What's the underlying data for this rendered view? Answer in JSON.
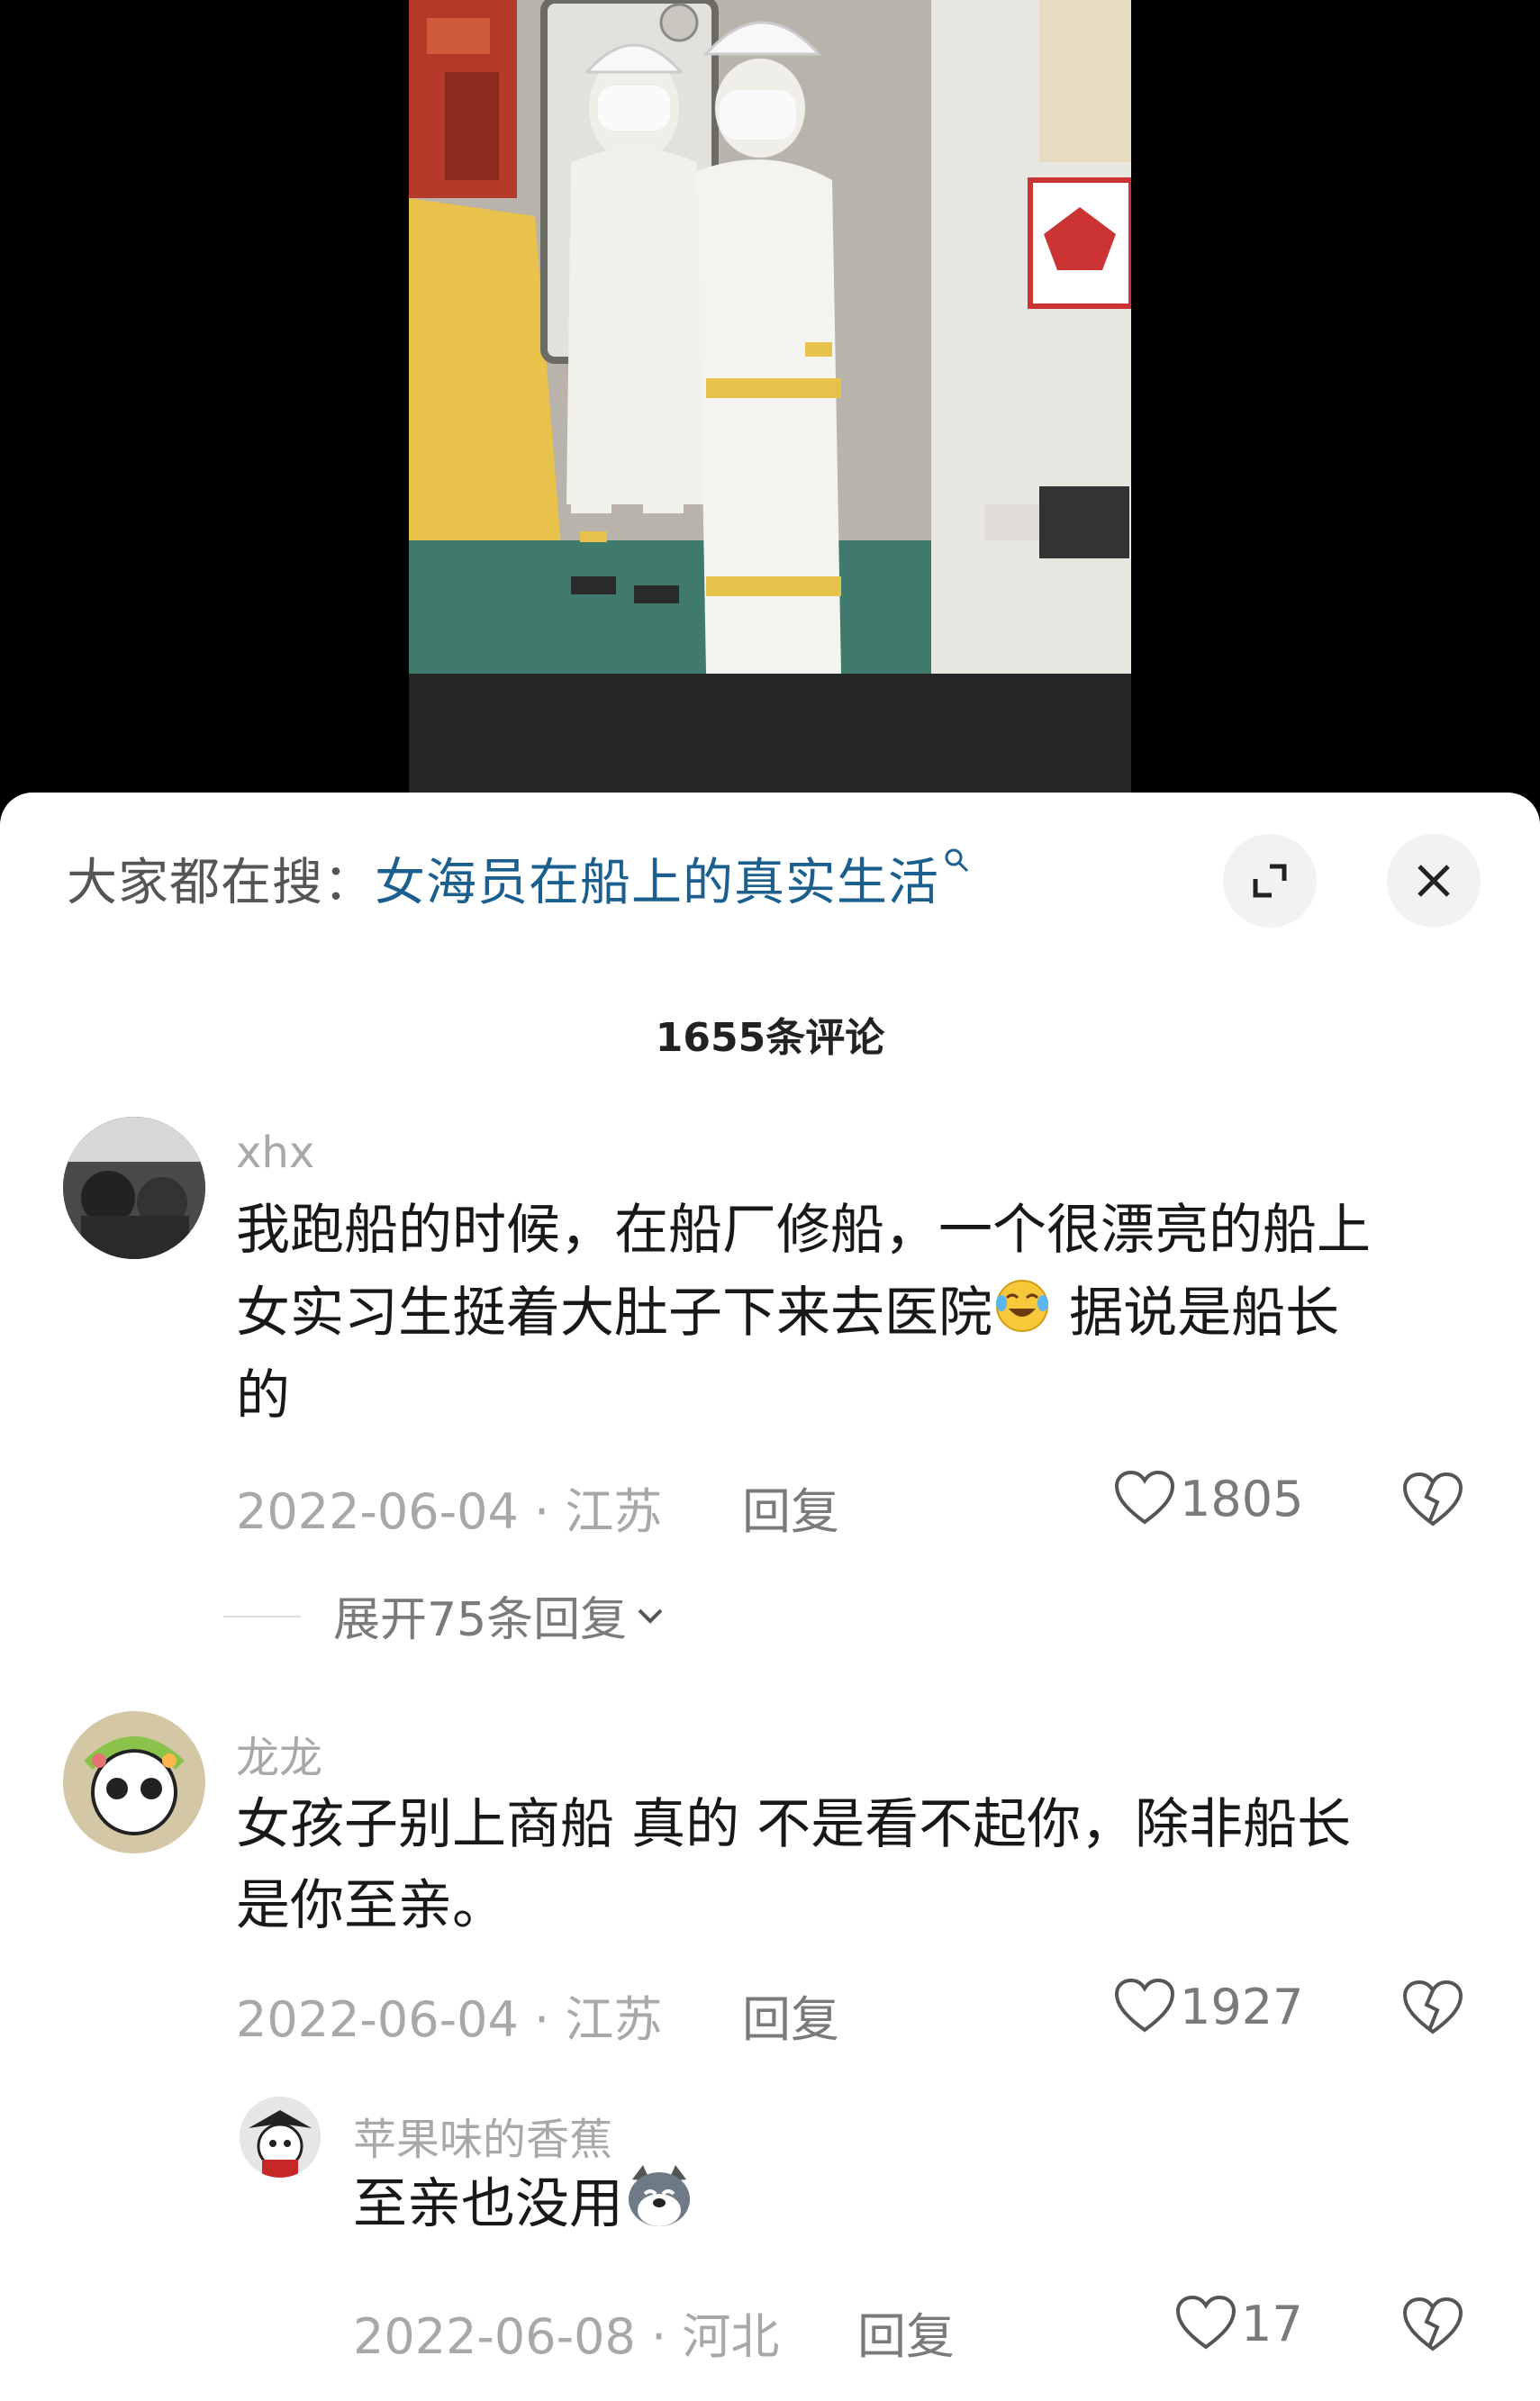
{
  "search": {
    "prefix": "大家都在搜：",
    "query": "女海员在船上的真实生活",
    "query_icon": "search-icon"
  },
  "header": {
    "comment_count": "1655条评论"
  },
  "colors": {
    "sheet_bg": "#ffffff",
    "search_link": "#1a5f8e",
    "meta_text": "#a8a8a8"
  },
  "comments": [
    {
      "username": "xhx",
      "text_line1": "我跑船的时候，在船厂修船，一个很漂亮的船上",
      "text_line2a": "女实习生挺着大肚子下来去医院",
      "emoji": "crying-laughing-emoji",
      "text_line2b": " 据说是船长",
      "text_line3": "的",
      "date": "2022-06-04",
      "separator": "·",
      "region": "江苏",
      "reply_label": "回复",
      "likes": "1805",
      "expand_replies": "展开75条回复"
    },
    {
      "username": "龙龙",
      "text_line1": "女孩子别上商船 真的  不是看不起你，除非船长",
      "text_line2": "是你至亲。",
      "date": "2022-06-04",
      "separator": "·",
      "region": "江苏",
      "reply_label": "回复",
      "likes": "1927"
    }
  ],
  "reply": {
    "username": "苹果味的香蕉",
    "text": "至亲也没用",
    "emoji": "doge-emoji",
    "date": "2022-06-08",
    "separator": "·",
    "region": "河北",
    "reply_label": "回复",
    "likes": "17"
  }
}
